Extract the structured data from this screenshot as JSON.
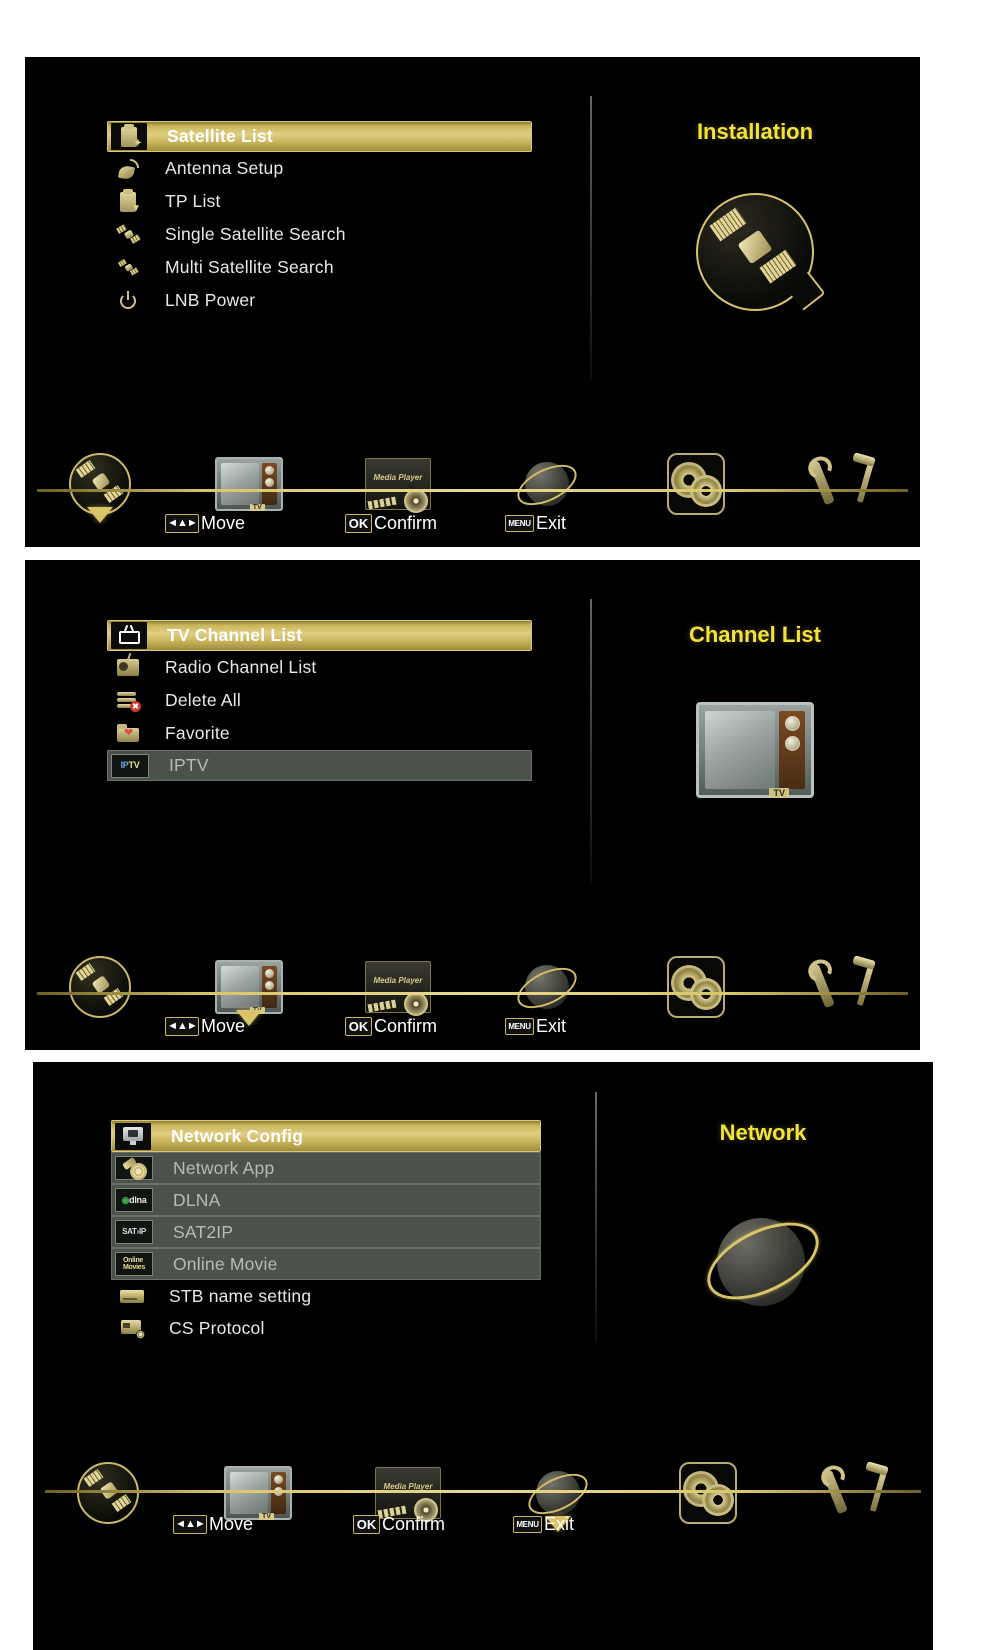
{
  "panels": [
    {
      "id": "installation",
      "title": "Installation",
      "title_icon": "satellite-dish-circle-icon",
      "menu": [
        {
          "label": "Satellite List",
          "icon": "clipboard-satellite-icon",
          "state": "selected"
        },
        {
          "label": "Antenna Setup",
          "icon": "antenna-dish-icon",
          "state": "normal"
        },
        {
          "label": "TP List",
          "icon": "clipboard-tp-icon",
          "state": "normal"
        },
        {
          "label": "Single Satellite Search",
          "icon": "satellite-icon",
          "state": "normal"
        },
        {
          "label": "Multi Satellite Search",
          "icon": "multi-satellite-icon",
          "state": "normal"
        },
        {
          "label": "LNB Power",
          "icon": "power-icon",
          "state": "normal"
        }
      ],
      "active_tab": 0
    },
    {
      "id": "channel-list",
      "title": "Channel List",
      "title_icon": "television-icon",
      "menu": [
        {
          "label": "TV Channel List",
          "icon": "tv-icon",
          "state": "selected"
        },
        {
          "label": "Radio Channel List",
          "icon": "radio-icon",
          "state": "normal"
        },
        {
          "label": "Delete All",
          "icon": "delete-all-icon",
          "state": "normal"
        },
        {
          "label": "Favorite",
          "icon": "favorite-folder-icon",
          "state": "normal"
        },
        {
          "label": "IPTV",
          "icon": "iptv-badge-icon",
          "state": "disabled"
        }
      ],
      "active_tab": 1
    },
    {
      "id": "network",
      "title": "Network",
      "title_icon": "globe-icon",
      "menu": [
        {
          "label": "Network Config",
          "icon": "network-monitor-icon",
          "state": "selected"
        },
        {
          "label": "Network App",
          "icon": "network-app-icon",
          "state": "disabled"
        },
        {
          "label": "DLNA",
          "icon": "dlna-badge-icon",
          "state": "disabled"
        },
        {
          "label": "SAT2IP",
          "icon": "sat2ip-badge-icon",
          "state": "disabled"
        },
        {
          "label": "Online Movie",
          "icon": "online-movie-icon",
          "state": "disabled"
        },
        {
          "label": "STB name setting",
          "icon": "stb-icon",
          "state": "normal"
        },
        {
          "label": "CS Protocol",
          "icon": "cs-card-icon",
          "state": "normal"
        }
      ],
      "active_tab": 3
    }
  ],
  "tabs": [
    {
      "name": "installation",
      "icon": "satellite-tab-icon"
    },
    {
      "name": "channel-list",
      "icon": "tv-tab-icon"
    },
    {
      "name": "media-player",
      "icon": "media-player-tab-icon",
      "label": "Media Player"
    },
    {
      "name": "network",
      "icon": "globe-tab-icon"
    },
    {
      "name": "system-setup",
      "icon": "gears-tab-icon"
    },
    {
      "name": "tools",
      "icon": "tools-tab-icon"
    }
  ],
  "hints": [
    {
      "key": "◄▲►",
      "key_type": "arrows",
      "text": "Move"
    },
    {
      "key": "OK",
      "key_type": "ok",
      "text": "Confirm"
    },
    {
      "key": "MENU",
      "key_type": "menu",
      "text": "Exit"
    }
  ],
  "badges": {
    "iptv_ip": "IP",
    "iptv_tv": "TV",
    "dlna_dot": "◉",
    "dlna_text": "dlna",
    "sat2ip": "SAT›IP",
    "online": "Online",
    "movies": "Movies",
    "tv_label": "TV"
  },
  "colors": {
    "background": "#000000",
    "page": "#ffffff",
    "gold": "#d9c46a",
    "gold_bright": "#e0cf84",
    "title_yellow": "#f2e23a",
    "text": "#e8e8e8",
    "disabled_bg": "#4b5249",
    "disabled_text": "#b6bbb4"
  }
}
